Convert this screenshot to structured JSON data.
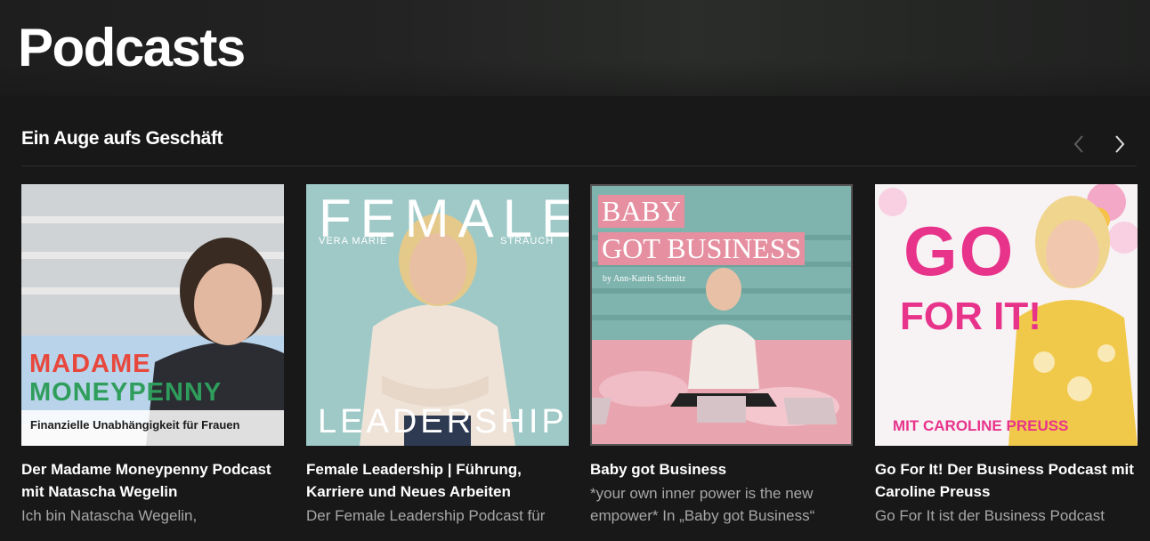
{
  "page": {
    "title": "Podcasts"
  },
  "shelf": {
    "title": "Ein Auge aufs Geschäft"
  },
  "covers": {
    "moneypenny": {
      "line1": "MADAME",
      "line2": "MONEYPENNY",
      "line3": "Finanzielle Unabhängigkeit für Frauen"
    },
    "female": {
      "top": "FEMALE",
      "first": "VERA MARIE",
      "last": "STRAUCH",
      "bottom": "LEADERSHIP"
    },
    "baby": {
      "line1": "BABY",
      "line2": "GOT BUSINESS",
      "byline": "by Ann-Katrin Schmitz"
    },
    "gofor": {
      "line1": "GO",
      "line2": "FOR IT!",
      "line3": "MIT CAROLINE PREUSS"
    }
  },
  "podcasts": [
    {
      "title_l1": "Der Madame Moneypenny Podcast",
      "title_l2": "mit Natascha Wegelin",
      "desc": "Ich bin Natascha Wegelin,"
    },
    {
      "title_l1": "Female Leadership | Führung,",
      "title_l2": "Karriere und Neues Arbeiten",
      "desc": "Der Female Leadership Podcast für"
    },
    {
      "title_l1": "Baby got Business",
      "desc_l1": "*your own inner power is the new",
      "desc_l2": "empower* In „Baby got Business“"
    },
    {
      "title_l1": "Go For It! Der Business Podcast mit",
      "title_l2": "Caroline Preuss",
      "desc": "Go For It ist der Business Podcast"
    }
  ],
  "colors": {
    "background": "#181818",
    "muted_text": "#a7a7a7",
    "moneypenny_bg": "#b9d3ea",
    "female_bg": "#9ec9c7",
    "baby_bg": "#7fb3ad",
    "gofor_pink": "#e8338b"
  }
}
